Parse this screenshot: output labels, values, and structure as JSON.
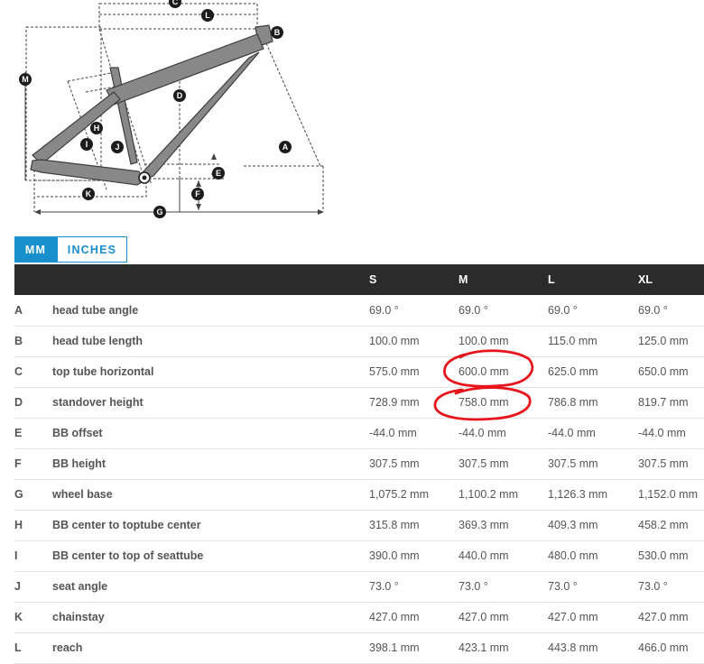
{
  "diagram": {
    "markers": [
      "A",
      "B",
      "C",
      "D",
      "E",
      "F",
      "G",
      "H",
      "I",
      "J",
      "K",
      "L",
      "M"
    ]
  },
  "unit_tabs": [
    {
      "label": "MM",
      "active": true
    },
    {
      "label": "INCHES",
      "active": false
    }
  ],
  "table": {
    "header": [
      "",
      "",
      "S",
      "M",
      "L",
      "XL"
    ],
    "rows": [
      {
        "letter": "A",
        "name": "head tube angle",
        "values": [
          "69.0 °",
          "69.0 °",
          "69.0 °",
          "69.0 °"
        ]
      },
      {
        "letter": "B",
        "name": "head tube length",
        "values": [
          "100.0 mm",
          "100.0 mm",
          "115.0 mm",
          "125.0 mm"
        ]
      },
      {
        "letter": "C",
        "name": "top tube horizontal",
        "values": [
          "575.0 mm",
          "600.0 mm",
          "625.0 mm",
          "650.0 mm"
        ]
      },
      {
        "letter": "D",
        "name": "standover height",
        "values": [
          "728.9 mm",
          "758.0 mm",
          "786.8 mm",
          "819.7 mm"
        ]
      },
      {
        "letter": "E",
        "name": "BB offset",
        "values": [
          "-44.0 mm",
          "-44.0 mm",
          "-44.0 mm",
          "-44.0 mm"
        ]
      },
      {
        "letter": "F",
        "name": "BB height",
        "values": [
          "307.5 mm",
          "307.5 mm",
          "307.5 mm",
          "307.5 mm"
        ]
      },
      {
        "letter": "G",
        "name": "wheel base",
        "values": [
          "1,075.2 mm",
          "1,100.2 mm",
          "1,126.3 mm",
          "1,152.0 mm"
        ]
      },
      {
        "letter": "H",
        "name": "BB center to toptube center",
        "values": [
          "315.8 mm",
          "369.3 mm",
          "409.3 mm",
          "458.2 mm"
        ]
      },
      {
        "letter": "I",
        "name": "BB center to top of seattube",
        "values": [
          "390.0 mm",
          "440.0 mm",
          "480.0 mm",
          "530.0 mm"
        ]
      },
      {
        "letter": "J",
        "name": "seat angle",
        "values": [
          "73.0 °",
          "73.0 °",
          "73.0 °",
          "73.0 °"
        ]
      },
      {
        "letter": "K",
        "name": "chainstay",
        "values": [
          "427.0 mm",
          "427.0 mm",
          "427.0 mm",
          "427.0 mm"
        ]
      },
      {
        "letter": "L",
        "name": "reach",
        "values": [
          "398.1 mm",
          "423.1 mm",
          "443.8 mm",
          "466.0 mm"
        ]
      }
    ]
  },
  "colors": {
    "accent": "#1a8fce",
    "header_bg": "#2b2b2b",
    "annotation": "#e8141b"
  }
}
